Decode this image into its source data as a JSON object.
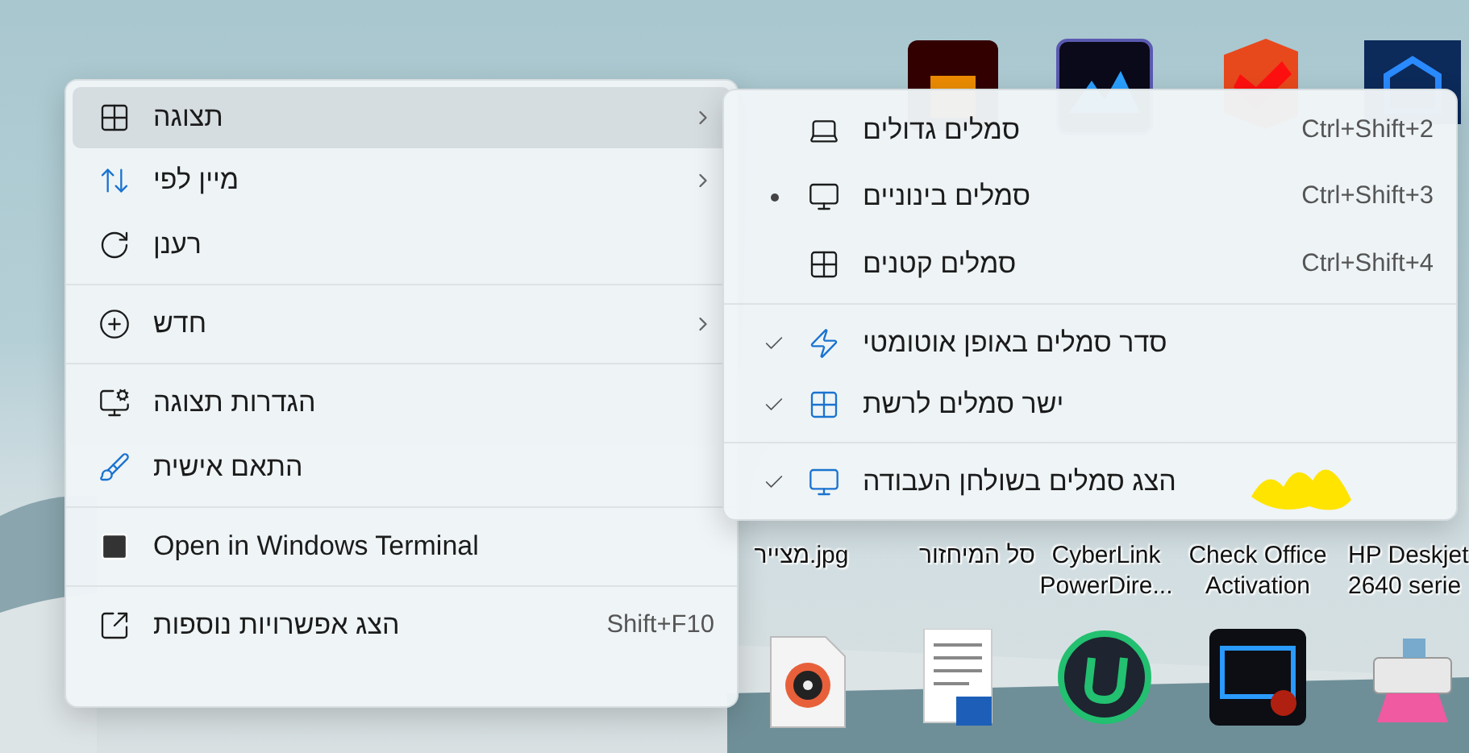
{
  "desktop_icons": [
    {
      "lines": [
        "HP Deskjet",
        "2640 serie"
      ]
    },
    {
      "lines": [
        "Check Office",
        "Activation"
      ]
    },
    {
      "lines": [
        "CyberLink",
        "PowerDire..."
      ]
    },
    {
      "lines": [
        "סל המיחזור"
      ]
    },
    {
      "lines": [
        "מצייר.jpg"
      ]
    }
  ],
  "main_menu": {
    "groups": [
      [
        {
          "label": "תצוגה",
          "has_submenu": true,
          "selected": true
        },
        {
          "label": "מיין לפי",
          "has_submenu": true,
          "selected": false
        },
        {
          "label": "רענן",
          "has_submenu": false,
          "selected": false
        }
      ],
      [
        {
          "label": "חדש",
          "has_submenu": true,
          "selected": false
        }
      ],
      [
        {
          "label": "הגדרות תצוגה",
          "has_submenu": false,
          "selected": false
        },
        {
          "label": "התאם אישית",
          "has_submenu": false,
          "selected": false
        }
      ],
      [
        {
          "label": "Open in Windows Terminal",
          "has_submenu": false,
          "selected": false
        }
      ],
      [
        {
          "label": "הצג אפשרויות נוספות",
          "shortcut": "Shift+F10",
          "has_submenu": false,
          "selected": false
        }
      ]
    ]
  },
  "view_submenu": {
    "groups": [
      [
        {
          "kind": "radio",
          "label": "סמלים גדולים",
          "shortcut": "Ctrl+Shift+2",
          "selected": false
        },
        {
          "kind": "radio",
          "label": "סמלים בינוניים",
          "shortcut": "Ctrl+Shift+3",
          "selected": true
        },
        {
          "kind": "radio",
          "label": "סמלים קטנים",
          "shortcut": "Ctrl+Shift+4",
          "selected": false
        }
      ],
      [
        {
          "kind": "check",
          "label": "סדר סמלים באופן אוטומטי",
          "checked": true
        },
        {
          "kind": "check",
          "label": "ישר סמלים לרשת",
          "checked": true
        }
      ],
      [
        {
          "kind": "check",
          "label": "הצג סמלים בשולחן העבודה",
          "checked": true
        }
      ]
    ]
  }
}
